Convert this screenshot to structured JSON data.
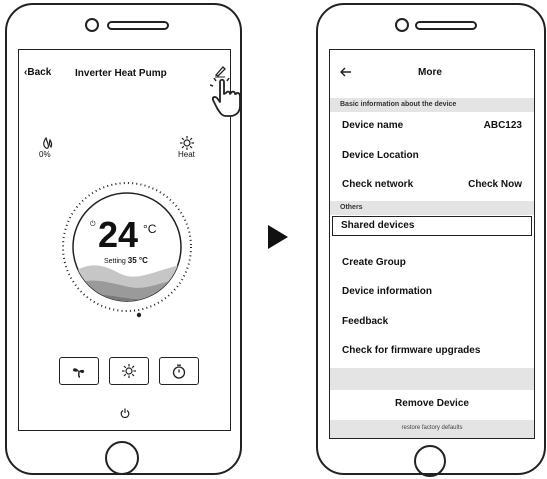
{
  "left_phone": {
    "header": {
      "back_label": "Back",
      "title": "Inverter Heat Pump",
      "edit_icon": "pencil-icon"
    },
    "status": {
      "humidity_icon": "water-drop-icon",
      "humidity_value": "0%",
      "mode_icon": "sun-icon",
      "mode_label": "Heat"
    },
    "dial": {
      "temperature": "24",
      "temperature_unit": "°C",
      "setting_label": "Setting",
      "setting_value": "35 °C"
    },
    "controls": {
      "fan_icon": "fan-icon",
      "mode_icon": "sun-icon",
      "timer_icon": "timer-icon",
      "power_icon": "power-icon"
    }
  },
  "arrow_icon": "right-triangle-icon",
  "right_phone": {
    "header": {
      "back_icon": "left-arrow-icon",
      "title": "More"
    },
    "section_basic": "Basic information about the device",
    "device_name_label": "Device name",
    "device_name_value": "ABC123",
    "device_location_label": "Device Location",
    "check_network_label": "Check network",
    "check_network_action": "Check Now",
    "section_others": "Others",
    "shared_devices_label": "Shared devices",
    "create_group_label": "Create Group",
    "device_information_label": "Device information",
    "feedback_label": "Feedback",
    "firmware_label": "Check for firmware upgrades",
    "remove_device_label": "Remove Device",
    "restore_label": "restore factory defaults"
  }
}
